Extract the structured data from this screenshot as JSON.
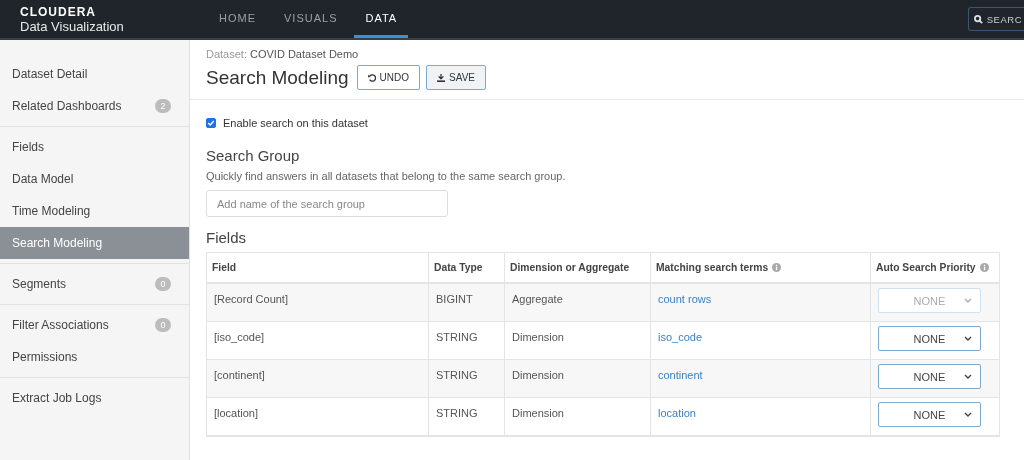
{
  "header": {
    "brand": "CLOUDERA",
    "product": "Data Visualization",
    "nav": [
      {
        "label": "HOME",
        "selected": false
      },
      {
        "label": "VISUALS",
        "selected": false
      },
      {
        "label": "DATA",
        "selected": true
      }
    ],
    "search": "SEARC"
  },
  "sidebar": {
    "groups": [
      [
        {
          "label": "Dataset Detail",
          "selected": false
        },
        {
          "label": "Related Dashboards",
          "badge": "2",
          "selected": false
        }
      ],
      [
        {
          "label": "Fields",
          "selected": false
        },
        {
          "label": "Data Model",
          "selected": false
        },
        {
          "label": "Time Modeling",
          "selected": false
        },
        {
          "label": "Search Modeling",
          "selected": true
        }
      ],
      [
        {
          "label": "Segments",
          "badge": "0",
          "selected": false
        }
      ],
      [
        {
          "label": "Filter Associations",
          "badge": "0",
          "selected": false
        },
        {
          "label": "Permissions",
          "selected": false
        }
      ],
      [
        {
          "label": "Extract Job Logs",
          "selected": false
        }
      ]
    ]
  },
  "breadcrumb": {
    "label": "Dataset:",
    "value": "COVID Dataset Demo"
  },
  "title": "Search Modeling",
  "buttons": [
    {
      "label": "UNDO",
      "kind": "undo"
    },
    {
      "label": "SAVE",
      "kind": "save"
    }
  ],
  "enable_search": {
    "label": "Enable search on this dataset",
    "checked": true
  },
  "search_group": {
    "title": "Search Group",
    "description": "Quickly find answers in all datasets that belong to the same search group.",
    "placeholder": "Add name of the search group"
  },
  "fields": {
    "title": "Fields",
    "columns": [
      {
        "label": "Field",
        "info": false
      },
      {
        "label": "Data Type",
        "info": false
      },
      {
        "label": "Dimension or Aggregate",
        "info": false
      },
      {
        "label": "Matching search terms",
        "info": true
      },
      {
        "label": "Auto Search Priority",
        "info": true
      }
    ],
    "rows": [
      {
        "field": "[Record Count]",
        "type": "BIGINT",
        "role": "Aggregate",
        "terms": "count rows",
        "priority": "NONE",
        "disabled": true
      },
      {
        "field": "[iso_code]",
        "type": "STRING",
        "role": "Dimension",
        "terms": "iso_code",
        "priority": "NONE",
        "disabled": false
      },
      {
        "field": "[continent]",
        "type": "STRING",
        "role": "Dimension",
        "terms": "continent",
        "priority": "NONE",
        "disabled": false
      },
      {
        "field": "[location]",
        "type": "STRING",
        "role": "Dimension",
        "terms": "location",
        "priority": "NONE",
        "disabled": false
      }
    ]
  }
}
